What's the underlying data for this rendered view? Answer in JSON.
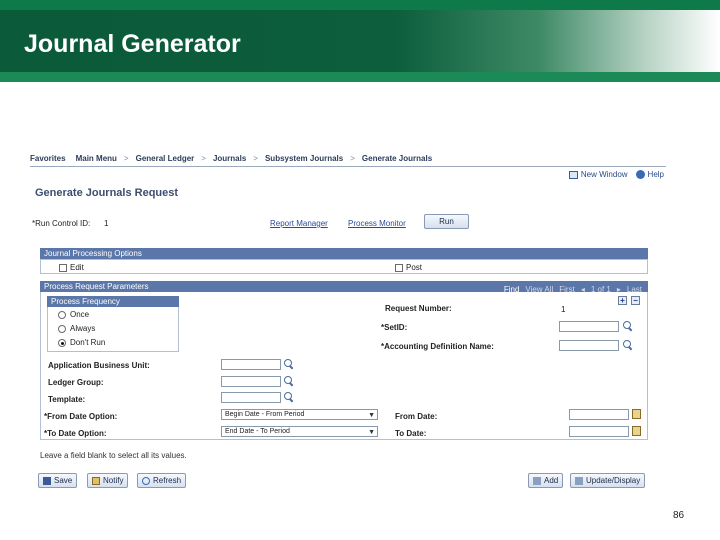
{
  "slide": {
    "title": "Journal Generator",
    "page_number": "86"
  },
  "menu": {
    "items": [
      "Favorites",
      "Main Menu",
      "General Ledger",
      "Journals",
      "Subsystem Journals",
      "Generate Journals"
    ],
    "separator": ">"
  },
  "toplinks": {
    "new_window": "New Window",
    "help": "Help"
  },
  "page": {
    "title": "Generate Journals Request"
  },
  "run_control": {
    "label": "*Run Control ID:",
    "value": "1",
    "report_manager": "Report Manager",
    "process_monitor": "Process Monitor",
    "run_button": "Run"
  },
  "journal_processing": {
    "header": "Journal Processing Options",
    "edit_label": "Edit",
    "post_label": "Post"
  },
  "process_request": {
    "header": "Process Request Parameters",
    "nav": {
      "find": "Find",
      "view_all": "View All",
      "first": "First",
      "count": "1 of 1",
      "last": "Last"
    },
    "frequency": {
      "header": "Process Frequency",
      "options": [
        "Once",
        "Always",
        "Don't Run"
      ],
      "selected": "Don't Run"
    },
    "request_number_label": "Request Number:",
    "request_number_value": "1",
    "setid_label": "*SetID:",
    "accounting_def_label": "*Accounting Definition Name:",
    "app_bu_label": "Application Business Unit:",
    "ledger_group_label": "Ledger Group:",
    "template_label": "Template:",
    "from_date_option_label": "*From Date Option:",
    "from_date_option_value": "Begin Date - From Period",
    "to_date_option_label": "*To Date Option:",
    "to_date_option_value": "End Date - To Period",
    "from_date_label": "From Date:",
    "to_date_label": "To Date:"
  },
  "hint": "Leave a field blank to select all its values.",
  "toolbar": {
    "save": "Save",
    "notify": "Notify",
    "refresh": "Refresh",
    "add": "Add",
    "update_display": "Update/Display"
  }
}
